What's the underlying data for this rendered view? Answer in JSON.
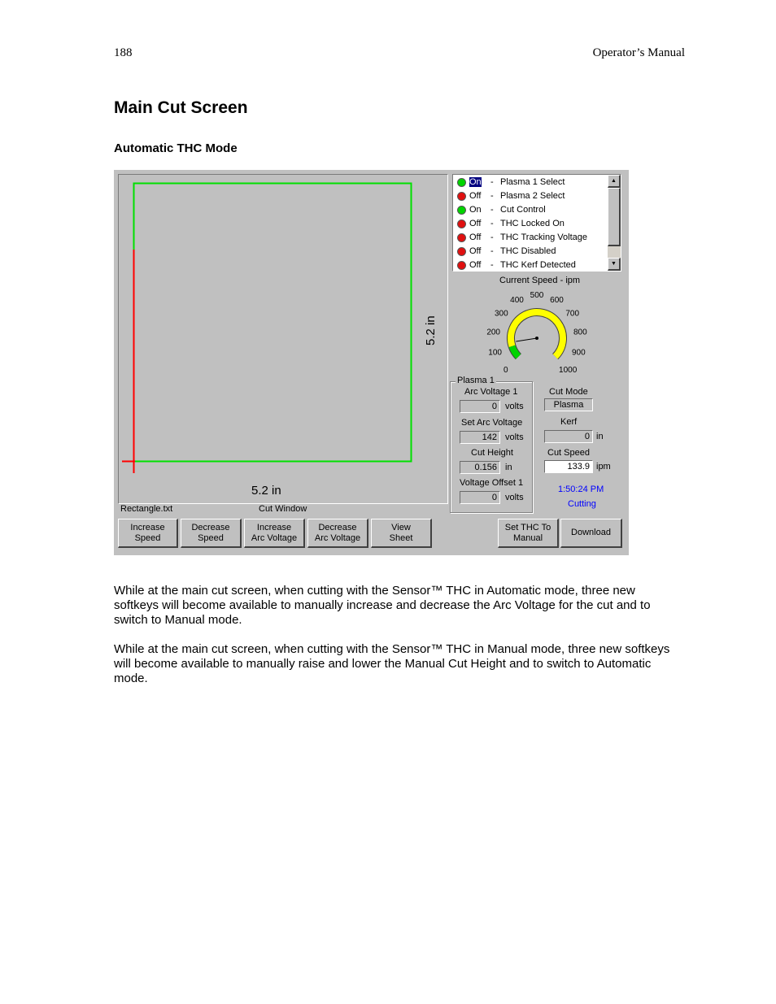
{
  "page": {
    "number": "188",
    "manual_title": "Operator’s Manual",
    "heading": "Main Cut Screen",
    "subheading": "Automatic THC Mode",
    "paragraph1": "While at the main cut screen, when cutting with the Sensor™ THC in Automatic mode, three new softkeys will become available to manually increase and decrease the Arc Voltage for the cut and to switch to Manual mode.",
    "paragraph2": "While at the main cut screen, when cutting with the Sensor™ THC in Manual mode, three new softkeys will become available to manually raise and lower the Manual Cut Height and to switch to Automatic mode."
  },
  "screen": {
    "cut_window": {
      "width_label": "5.2 in",
      "height_label": "5.2 in",
      "file_name": "Rectangle.txt",
      "caption": "Cut Window"
    },
    "status_list": [
      {
        "state": "On",
        "name": "Plasma 1 Select",
        "color": "#00d400",
        "selected": true
      },
      {
        "state": "Off",
        "name": "Plasma 2 Select",
        "color": "#e01010",
        "selected": false
      },
      {
        "state": "On",
        "name": "Cut Control",
        "color": "#00d400",
        "selected": false
      },
      {
        "state": "Off",
        "name": "THC Locked On",
        "color": "#e01010",
        "selected": false
      },
      {
        "state": "Off",
        "name": "THC Tracking Voltage",
        "color": "#e01010",
        "selected": false
      },
      {
        "state": "Off",
        "name": "THC Disabled",
        "color": "#e01010",
        "selected": false
      },
      {
        "state": "Off",
        "name": "THC Kerf Detected",
        "color": "#e01010",
        "selected": false
      }
    ],
    "separator": "-",
    "gauge": {
      "title": "Current Speed - ipm",
      "ticks": [
        "0",
        "100",
        "200",
        "300",
        "400",
        "500",
        "600",
        "700",
        "800",
        "900",
        "1000"
      ],
      "min": 0,
      "max": 1000,
      "value": 133.9,
      "green_until": 100,
      "colors": {
        "arc": "#ffff00",
        "low": "#00d400"
      }
    },
    "plasma": {
      "group_title": "Plasma 1",
      "arc_voltage_label": "Arc Voltage 1",
      "arc_voltage": "0",
      "set_arc_voltage_label": "Set Arc Voltage",
      "set_arc_voltage": "142",
      "cut_height_label": "Cut Height",
      "cut_height": "0.156",
      "voltage_offset_label": "Voltage Offset 1",
      "voltage_offset": "0",
      "volts": "volts",
      "in": "in"
    },
    "cut_mode_label": "Cut Mode",
    "cut_mode": "Plasma",
    "kerf_label": "Kerf",
    "kerf": "0",
    "kerf_unit": "in",
    "cut_speed_label": "Cut Speed",
    "cut_speed": "133.9",
    "cut_speed_unit": "ipm",
    "time": "1:50:24 PM",
    "status": "Cutting",
    "status_color": "#0000ff",
    "buttons": {
      "increase_speed": [
        "Increase",
        "Speed"
      ],
      "decrease_speed": [
        "Decrease",
        "Speed"
      ],
      "increase_arc": [
        "Increase",
        "Arc Voltage"
      ],
      "decrease_arc": [
        "Decrease",
        "Arc Voltage"
      ],
      "view_sheet": [
        "View",
        "Sheet"
      ],
      "set_thc_manual": [
        "Set THC To",
        "Manual"
      ],
      "download": "Download"
    }
  }
}
